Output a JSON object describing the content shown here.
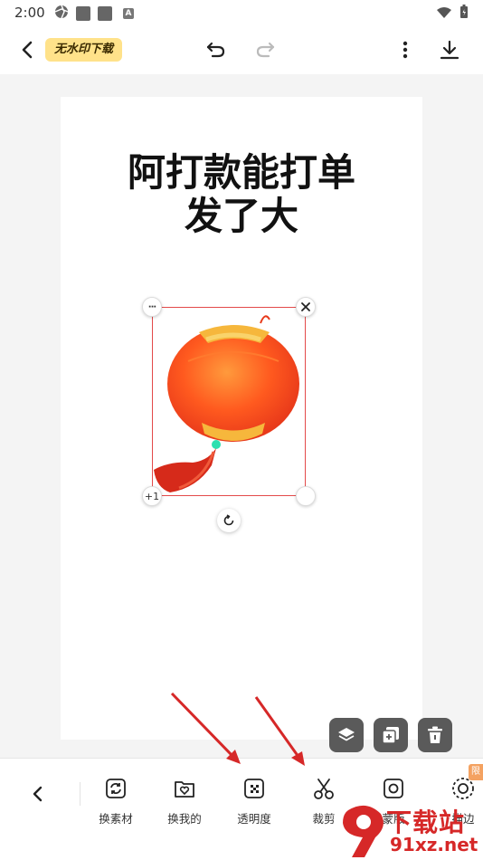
{
  "status_bar": {
    "time": "2:00",
    "small_badge": "A"
  },
  "toolbar": {
    "watermark_badge": "无水印下载"
  },
  "canvas": {
    "title_line1": "阿打款能打单",
    "title_line2": "发了大",
    "handle_bl_label": "+1",
    "handle_tl_label": "···"
  },
  "bottom_tools": [
    {
      "label": "换素材",
      "icon": "swap-asset-icon"
    },
    {
      "label": "换我的",
      "icon": "folder-heart-icon"
    },
    {
      "label": "透明度",
      "icon": "transparency-icon"
    },
    {
      "label": "裁剪",
      "icon": "scissors-icon"
    },
    {
      "label": "蒙版",
      "icon": "mask-icon"
    },
    {
      "label": "描边",
      "icon": "stroke-icon"
    }
  ],
  "corner_badge": "限",
  "overlay_logo": {
    "text_cn": "下载站",
    "text_url": "91xz.net"
  },
  "colors": {
    "accent_badge": "#ffe28a",
    "selection": "#e34a4a",
    "arrow": "#d62828",
    "fab": "#5a5a5a"
  }
}
